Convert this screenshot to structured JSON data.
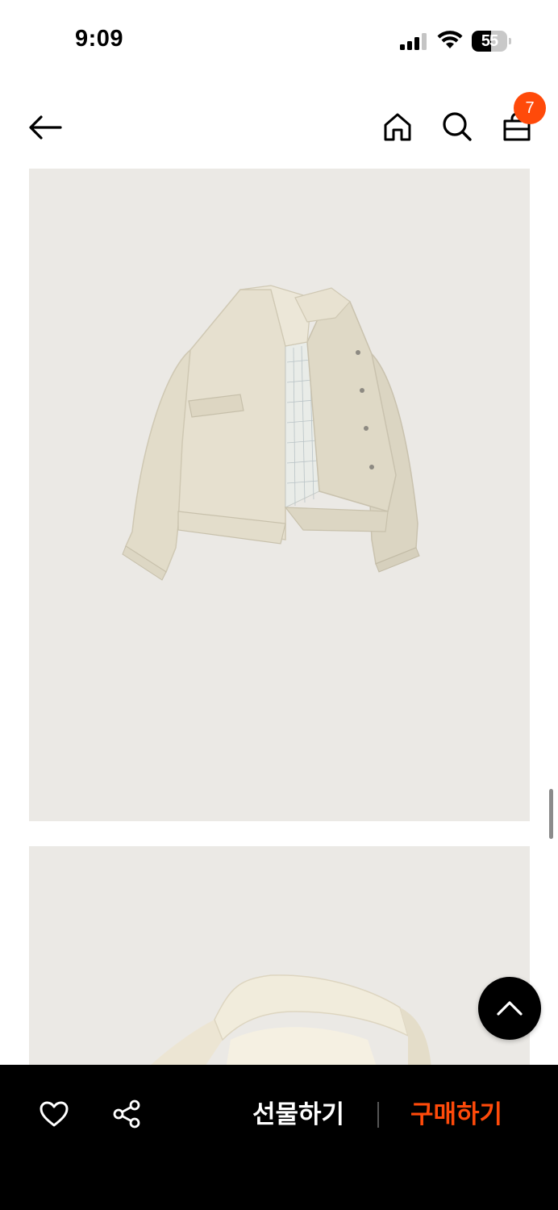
{
  "status_bar": {
    "time": "9:09",
    "battery_level": "55",
    "battery_fraction": 0.55
  },
  "header": {
    "icons": [
      "back-arrow-icon",
      "home-icon",
      "search-icon",
      "shopping-bag-icon"
    ],
    "cart_count": "7",
    "badge_color": "#ff4a0a"
  },
  "product": {
    "images": [
      "jacket-front-open-photo",
      "jacket-collar-detail-photo"
    ],
    "background_color": "#ebe9e5"
  },
  "bottom_bar": {
    "gift_label": "선물하기",
    "buy_label": "구매하기",
    "buy_color": "#ff4a0a",
    "icons": [
      "heart-icon",
      "share-icon"
    ]
  }
}
